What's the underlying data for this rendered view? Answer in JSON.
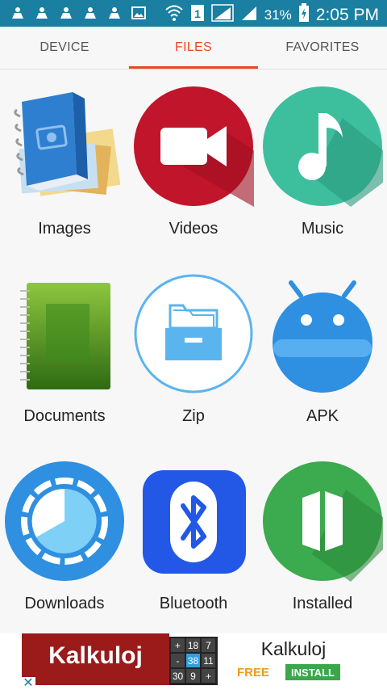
{
  "status_bar": {
    "battery_percent": "31%",
    "time": "2:05 PM",
    "notification_icons": [
      "notification-person-icon",
      "notification-person-icon",
      "notification-person-icon",
      "notification-person-icon",
      "notification-person-icon",
      "image-icon"
    ],
    "status_icons": [
      "wifi-icon",
      "sim-1-icon",
      "signal-icon",
      "signal-icon",
      "battery-charging-icon"
    ]
  },
  "tabs": [
    {
      "label": "DEVICE",
      "active": false
    },
    {
      "label": "FILES",
      "active": true
    },
    {
      "label": "FAVORITES",
      "active": false
    }
  ],
  "categories": [
    {
      "label": "Images",
      "icon": "images-book-icon"
    },
    {
      "label": "Videos",
      "icon": "video-camera-icon"
    },
    {
      "label": "Music",
      "icon": "music-note-icon"
    },
    {
      "label": "Documents",
      "icon": "notebook-icon"
    },
    {
      "label": "Zip",
      "icon": "archive-box-icon"
    },
    {
      "label": "APK",
      "icon": "android-icon"
    },
    {
      "label": "Downloads",
      "icon": "pie-chart-icon"
    },
    {
      "label": "Bluetooth",
      "icon": "bluetooth-icon"
    },
    {
      "label": "Installed",
      "icon": "installed-icon"
    }
  ],
  "ad": {
    "banner_text": "Kalkuloj",
    "title": "Kalkuloj",
    "free_label": "FREE",
    "install_label": "INSTALL",
    "calc_keys": [
      "+",
      "18",
      "7",
      "-",
      "38",
      "11",
      "30",
      "9",
      "+"
    ]
  },
  "colors": {
    "status_bar": "#1a7fa0",
    "accent": "#e8472a",
    "videos": "#c0152b",
    "music": "#3dbf9e",
    "apk": "#2f8fe0",
    "downloads": "#2f8fe0",
    "bluetooth": "#2357e6",
    "installed": "#3caa4e"
  }
}
